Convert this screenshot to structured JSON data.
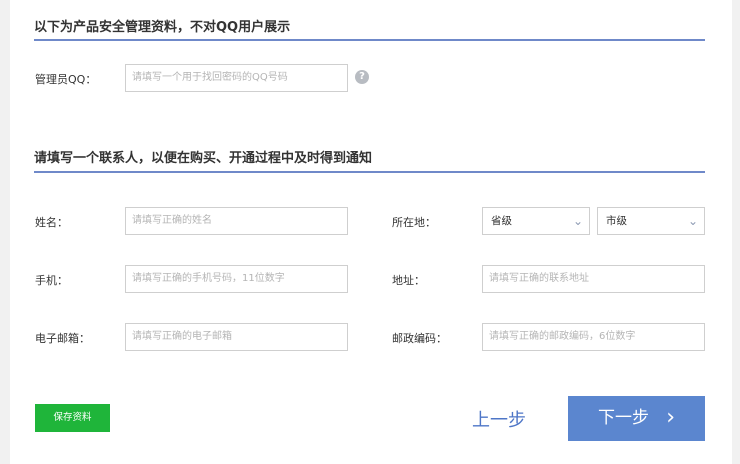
{
  "admin_section": {
    "title": "以下为产品安全管理资料，不对QQ用户展示",
    "qq_label": "管理员QQ：",
    "qq_placeholder": "请填写一个用于找回密码的QQ号码",
    "help_icon": "?"
  },
  "contact_section": {
    "title": "请填写一个联系人，以便在购买、开通过程中及时得到通知",
    "name_label": "姓名：",
    "name_placeholder": "请填写正确的姓名",
    "location_label": "所在地：",
    "province_value": "省级",
    "city_value": "市级",
    "chevron": "⌄",
    "phone_label": "手机：",
    "phone_placeholder": "请填写正确的手机号码，11位数字",
    "address_label": "地址：",
    "address_placeholder": "请填写正确的联系地址",
    "email_label": "电子邮箱：",
    "email_placeholder": "请填写正确的电子邮箱",
    "postcode_label": "邮政编码：",
    "postcode_placeholder": "请填写正确的邮政编码，6位数字"
  },
  "actions": {
    "save_label": "保存资料",
    "prev_label": "上一步",
    "next_label": "下一步",
    "next_arrow": "›"
  },
  "colors": {
    "accent": "#5b86cf",
    "save_green": "#1fb53a",
    "section_line": "#6f89c9"
  }
}
